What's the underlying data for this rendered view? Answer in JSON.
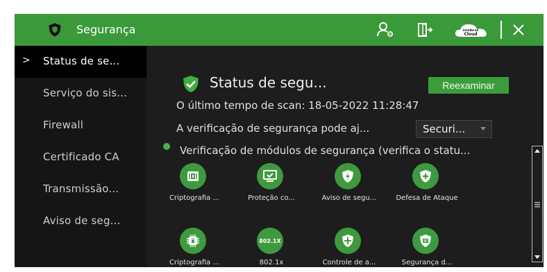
{
  "titlebar": {
    "title": "Segurança",
    "icons": [
      "shield-icon",
      "user-settings-icon",
      "exit-door-icon",
      "cloud-icon",
      "close-icon"
    ],
    "cloud_text_top": "intelbras",
    "cloud_text_bottom": "Cloud"
  },
  "sidebar": {
    "items": [
      {
        "label": "Status de se...",
        "active": true
      },
      {
        "label": "Serviço do sis..."
      },
      {
        "label": "Firewall"
      },
      {
        "label": "Certificado CA"
      },
      {
        "label": "Transmissão..."
      },
      {
        "label": "Aviso de seg..."
      }
    ],
    "active_marker": ">"
  },
  "main": {
    "status_title": "Status de segu...",
    "rescan_label": "Reexaminar",
    "last_scan": "O último tempo de scan: 18-05-2022 11:28:47",
    "assist_text": "A verificação de segurança pode aj...",
    "select_value": "Securi...",
    "modules_heading": "Verificação de módulos de segurança (verifica o statu...",
    "modules": [
      {
        "label": "Criptografia ...",
        "icon": "encryption-icon"
      },
      {
        "label": "Proteção co...",
        "icon": "monitor-protection-icon"
      },
      {
        "label": "Aviso de segu...",
        "icon": "alert-shield-icon"
      },
      {
        "label": "Defesa de Ataque",
        "icon": "attack-defense-icon"
      },
      {
        "label": "Criptografia ...",
        "icon": "chip-encryption-icon"
      },
      {
        "label": "802.1x",
        "icon": "802-1x-icon",
        "badge": "802.1X"
      },
      {
        "label": "Controle de a...",
        "icon": "access-control-icon"
      },
      {
        "label": "Segurança d...",
        "icon": "data-security-icon"
      }
    ]
  },
  "colors": {
    "accent": "#3a9a3a",
    "panel": "#1d1d1d",
    "sidebar": "#151515"
  }
}
